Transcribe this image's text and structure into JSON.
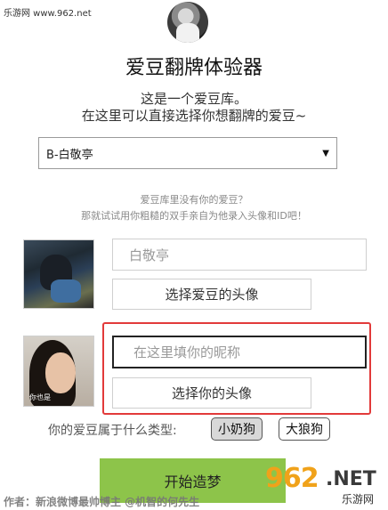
{
  "watermark_top": "乐游网 www.962.net",
  "header": {
    "title": "爱豆翻牌体验器",
    "subtitle_line1": "这是一个爱豆库。",
    "subtitle_line2": "在这里可以直接选择你想翻牌的爱豆~"
  },
  "idol_select": {
    "selected": "B-白敬亭"
  },
  "hint": {
    "line1": "爱豆库里没有你的爱豆？",
    "line2": "那就试试用你粗糙的双手亲自为他录入头像和ID吧！"
  },
  "idol_form": {
    "name_value": "白敬亭",
    "pick_avatar_label": "选择爱豆的头像"
  },
  "self_form": {
    "nickname_placeholder": "在这里填你的昵称",
    "nickname_value": "",
    "pick_avatar_label": "选择你的头像",
    "photo_caption": "你也是"
  },
  "type_question": {
    "label": "你的爱豆属于什么类型:",
    "options": [
      "小奶狗",
      "大狼狗"
    ],
    "selected": "小奶狗"
  },
  "start_button": "开始造梦",
  "author": "作者：新浪微博最帅博主 @机智的何先生",
  "logo": {
    "number": "962",
    "suffix": ".NET",
    "cn": "乐游网"
  },
  "colors": {
    "accent_green": "#8dc44a",
    "highlight_red": "#e23a3a",
    "logo_orange": "#f0a21a"
  }
}
